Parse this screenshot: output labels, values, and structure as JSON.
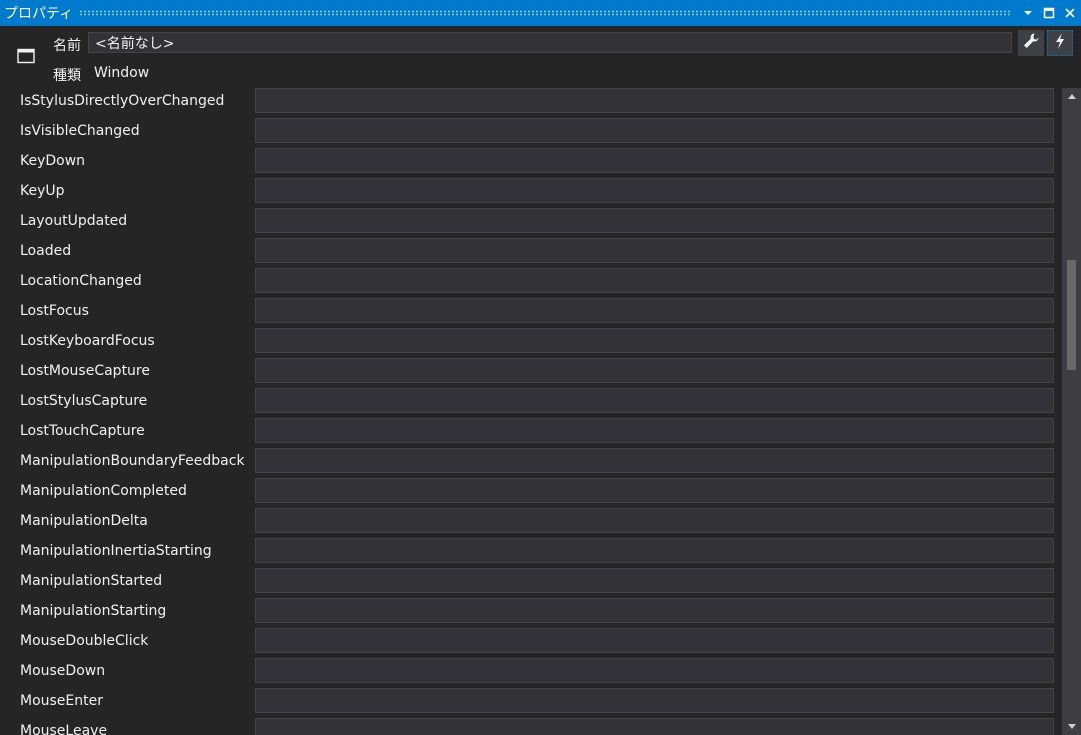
{
  "titlebar": {
    "title": "プロパティ",
    "icons": [
      "dropdown-arrow-icon",
      "maximize-icon",
      "close-icon"
    ]
  },
  "header": {
    "name_label": "名前",
    "name_value": "<名前なし>",
    "type_label": "種類",
    "type_value": "Window",
    "buttons": [
      "wrench-icon",
      "lightning-icon"
    ]
  },
  "events": [
    {
      "name": "IsStylusDirectlyOverChanged",
      "handler": ""
    },
    {
      "name": "IsVisibleChanged",
      "handler": ""
    },
    {
      "name": "KeyDown",
      "handler": ""
    },
    {
      "name": "KeyUp",
      "handler": ""
    },
    {
      "name": "LayoutUpdated",
      "handler": ""
    },
    {
      "name": "Loaded",
      "handler": ""
    },
    {
      "name": "LocationChanged",
      "handler": ""
    },
    {
      "name": "LostFocus",
      "handler": ""
    },
    {
      "name": "LostKeyboardFocus",
      "handler": ""
    },
    {
      "name": "LostMouseCapture",
      "handler": ""
    },
    {
      "name": "LostStylusCapture",
      "handler": ""
    },
    {
      "name": "LostTouchCapture",
      "handler": ""
    },
    {
      "name": "ManipulationBoundaryFeedback",
      "handler": ""
    },
    {
      "name": "ManipulationCompleted",
      "handler": ""
    },
    {
      "name": "ManipulationDelta",
      "handler": ""
    },
    {
      "name": "ManipulationInertiaStarting",
      "handler": ""
    },
    {
      "name": "ManipulationStarted",
      "handler": ""
    },
    {
      "name": "ManipulationStarting",
      "handler": ""
    },
    {
      "name": "MouseDoubleClick",
      "handler": ""
    },
    {
      "name": "MouseDown",
      "handler": ""
    },
    {
      "name": "MouseEnter",
      "handler": ""
    },
    {
      "name": "MouseLeave",
      "handler": ""
    }
  ],
  "colors": {
    "accent": "#007acc",
    "background": "#252526",
    "input_bg": "#333337",
    "input_border": "#434346",
    "text": "#f1f1f1"
  }
}
